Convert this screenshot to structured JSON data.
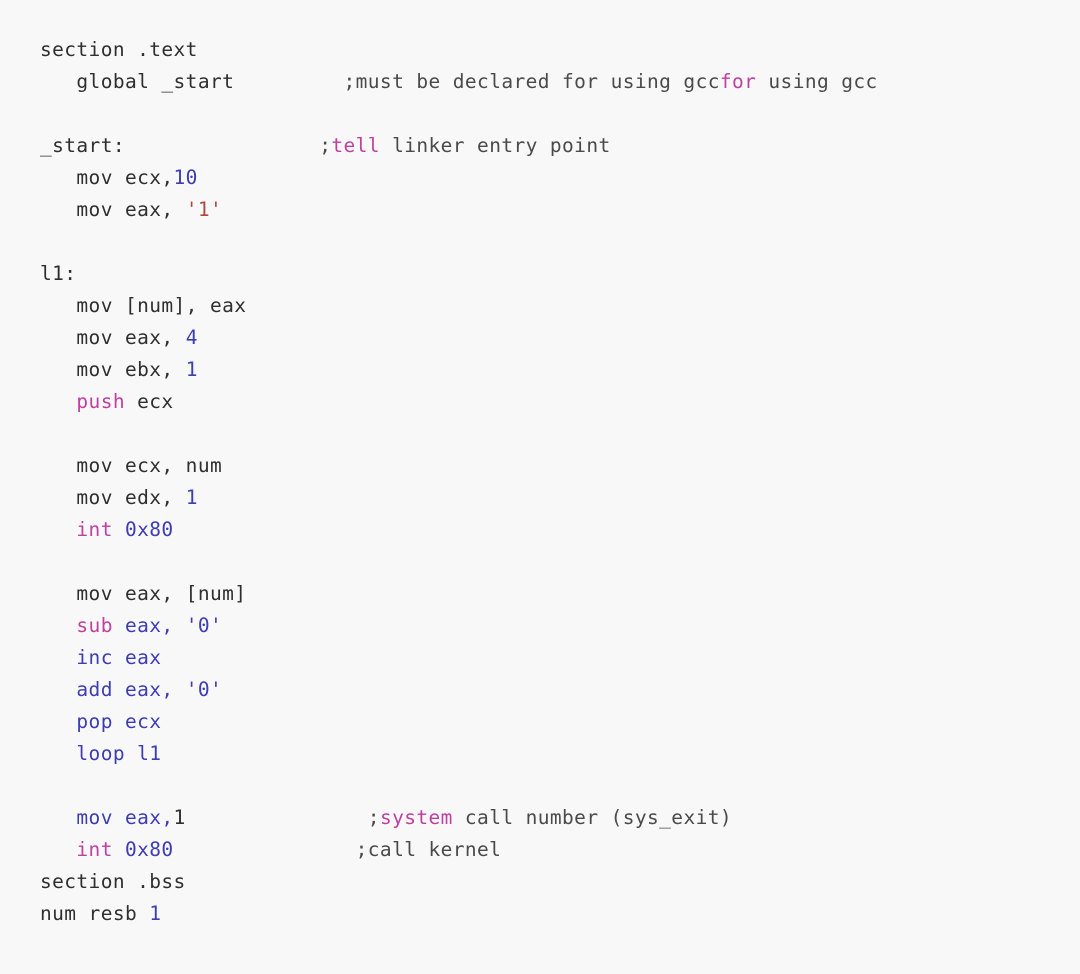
{
  "document": {
    "title": "x86 assembly source listing",
    "language": "nasm",
    "background_color": "#f8f8f8"
  },
  "colors": {
    "plain": "#2f2f2f",
    "keyword": "#c13fa0",
    "operand": "#3c3cb4",
    "number": "#3c3cb4",
    "char_literal": "#b5443c",
    "comment": "#4a4a4a",
    "comment_keyword": "#c13fa0"
  },
  "code": {
    "lines": [
      {
        "id": "line-1",
        "segments": [
          {
            "text": "section .text",
            "cls": "t-plain"
          }
        ]
      },
      {
        "id": "line-2",
        "segments": [
          {
            "text": "   global _start",
            "cls": "t-plain"
          },
          {
            "text": "         ;must be declared for using gcc",
            "cls": "t-comment"
          },
          {
            "text": "for",
            "cls": "t-cmtkey"
          },
          {
            "text": " using gcc",
            "cls": "t-comment"
          }
        ]
      },
      {
        "id": "line-3",
        "segments": []
      },
      {
        "id": "line-4",
        "segments": [
          {
            "text": "_start:",
            "cls": "t-label"
          },
          {
            "text": "                ;",
            "cls": "t-comment"
          },
          {
            "text": "tell",
            "cls": "t-cmtkey"
          },
          {
            "text": " linker entry point",
            "cls": "t-comment"
          }
        ]
      },
      {
        "id": "line-5",
        "segments": [
          {
            "text": "   mov ecx,",
            "cls": "t-plain"
          },
          {
            "text": "10",
            "cls": "t-num"
          }
        ]
      },
      {
        "id": "line-6",
        "segments": [
          {
            "text": "   mov eax, ",
            "cls": "t-plain"
          },
          {
            "text": "'1'",
            "cls": "t-char"
          }
        ]
      },
      {
        "id": "line-7",
        "segments": []
      },
      {
        "id": "line-8",
        "segments": [
          {
            "text": "l1:",
            "cls": "t-label"
          }
        ]
      },
      {
        "id": "line-9",
        "segments": [
          {
            "text": "   mov [num], eax",
            "cls": "t-plain"
          }
        ]
      },
      {
        "id": "line-10",
        "segments": [
          {
            "text": "   mov eax, ",
            "cls": "t-plain"
          },
          {
            "text": "4",
            "cls": "t-num"
          }
        ]
      },
      {
        "id": "line-11",
        "segments": [
          {
            "text": "   mov ebx, ",
            "cls": "t-plain"
          },
          {
            "text": "1",
            "cls": "t-num"
          }
        ]
      },
      {
        "id": "line-12",
        "segments": [
          {
            "text": "   ",
            "cls": "t-plain"
          },
          {
            "text": "push",
            "cls": "t-keyword"
          },
          {
            "text": " ecx",
            "cls": "t-plain"
          }
        ]
      },
      {
        "id": "line-13",
        "segments": []
      },
      {
        "id": "line-14",
        "segments": [
          {
            "text": "   mov ecx, num",
            "cls": "t-plain"
          }
        ]
      },
      {
        "id": "line-15",
        "segments": [
          {
            "text": "   mov edx, ",
            "cls": "t-plain"
          },
          {
            "text": "1",
            "cls": "t-num"
          }
        ]
      },
      {
        "id": "line-16",
        "segments": [
          {
            "text": "   ",
            "cls": "t-plain"
          },
          {
            "text": "int",
            "cls": "t-keyword"
          },
          {
            "text": " ",
            "cls": "t-plain"
          },
          {
            "text": "0x80",
            "cls": "t-num"
          }
        ]
      },
      {
        "id": "line-17",
        "segments": []
      },
      {
        "id": "line-18",
        "segments": [
          {
            "text": "   mov eax, [num]",
            "cls": "t-plain"
          }
        ]
      },
      {
        "id": "line-19",
        "segments": [
          {
            "text": "   ",
            "cls": "t-plain"
          },
          {
            "text": "sub",
            "cls": "t-keyword"
          },
          {
            "text": " eax, ",
            "cls": "t-op"
          },
          {
            "text": "'0'",
            "cls": "t-charblue"
          }
        ]
      },
      {
        "id": "line-20",
        "segments": [
          {
            "text": "   ",
            "cls": "t-plain"
          },
          {
            "text": "inc eax",
            "cls": "t-op"
          }
        ]
      },
      {
        "id": "line-21",
        "segments": [
          {
            "text": "   ",
            "cls": "t-plain"
          },
          {
            "text": "add eax, ",
            "cls": "t-op"
          },
          {
            "text": "'0'",
            "cls": "t-charblue"
          }
        ]
      },
      {
        "id": "line-22",
        "segments": [
          {
            "text": "   ",
            "cls": "t-plain"
          },
          {
            "text": "pop ecx",
            "cls": "t-op"
          }
        ]
      },
      {
        "id": "line-23",
        "segments": [
          {
            "text": "   ",
            "cls": "t-plain"
          },
          {
            "text": "loop l1",
            "cls": "t-op"
          }
        ]
      },
      {
        "id": "line-24",
        "segments": []
      },
      {
        "id": "line-25",
        "segments": [
          {
            "text": "   ",
            "cls": "t-plain"
          },
          {
            "text": "mov eax,",
            "cls": "t-op"
          },
          {
            "text": "1",
            "cls": "t-plain"
          },
          {
            "text": "               ;",
            "cls": "t-comment"
          },
          {
            "text": "system",
            "cls": "t-cmtkey"
          },
          {
            "text": " call number (sys_exit)",
            "cls": "t-comment"
          }
        ]
      },
      {
        "id": "line-26",
        "segments": [
          {
            "text": "   ",
            "cls": "t-plain"
          },
          {
            "text": "int",
            "cls": "t-keyword"
          },
          {
            "text": " ",
            "cls": "t-plain"
          },
          {
            "text": "0x80",
            "cls": "t-num"
          },
          {
            "text": "               ;call kernel",
            "cls": "t-comment"
          }
        ]
      },
      {
        "id": "line-27",
        "segments": [
          {
            "text": "section .bss",
            "cls": "t-plain"
          }
        ]
      },
      {
        "id": "line-28",
        "segments": [
          {
            "text": "num resb ",
            "cls": "t-plain"
          },
          {
            "text": "1",
            "cls": "t-num"
          }
        ]
      }
    ]
  }
}
